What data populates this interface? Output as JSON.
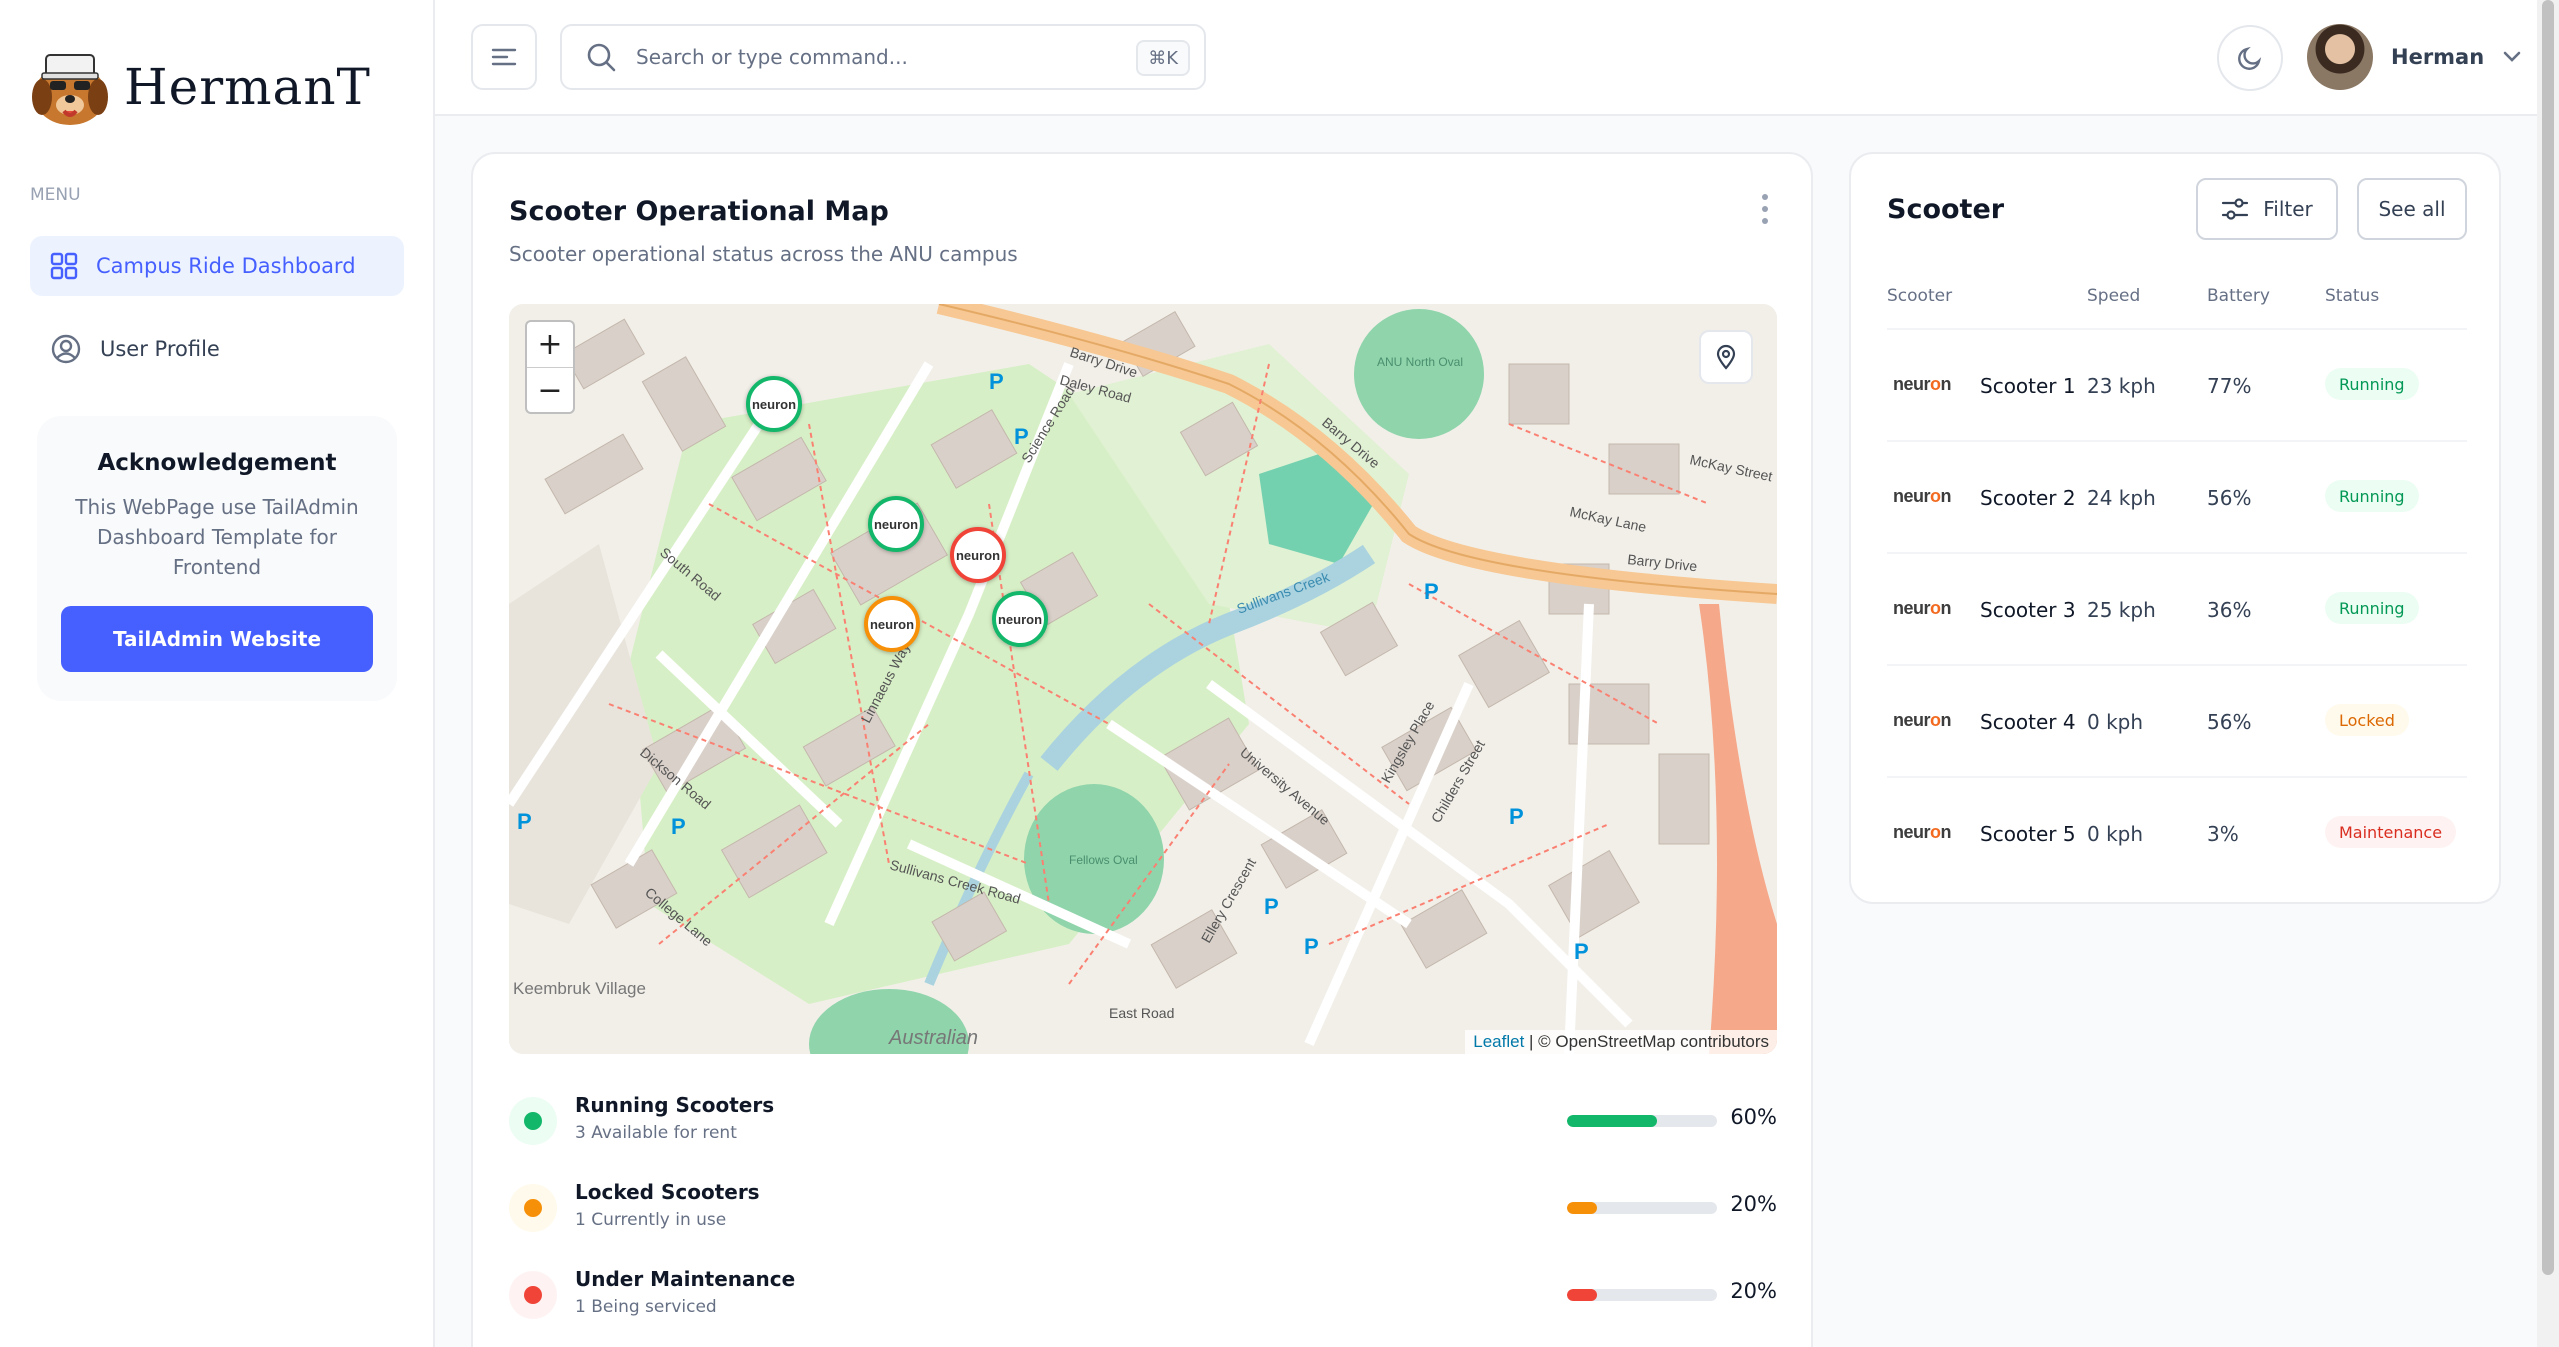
{
  "brand": {
    "name": "HermanT"
  },
  "sidebar": {
    "menu_label": "MENU",
    "items": [
      {
        "label": "Campus Ride Dashboard",
        "icon": "grid-icon",
        "active": true
      },
      {
        "label": "User Profile",
        "icon": "user-circle-icon",
        "active": false
      }
    ],
    "ack": {
      "title": "Acknowledgement",
      "text": "This WebPage use TailAdmin Dashboard Template for Frontend",
      "button": "TailAdmin Website"
    }
  },
  "header": {
    "search_placeholder": "Search or type command...",
    "shortcut": "⌘K",
    "user_name": "Herman"
  },
  "map_card": {
    "title": "Scooter Operational Map",
    "subtitle": "Scooter operational status across the ANU campus",
    "zoom_in": "+",
    "zoom_out": "−",
    "attribution_link": "Leaflet",
    "attribution_text": "| © OpenStreetMap contributors",
    "marker_label": "neuron",
    "map_labels": {
      "barry_drive_1": "Barry Drive",
      "barry_drive_2": "Barry Drive",
      "barry_drive_3": "Barry Drive",
      "daley_road": "Daley Road",
      "north_oval": "ANU North Oval",
      "fellows_oval": "Fellows Oval",
      "university_ave": "University Avenue",
      "sullivans_creek": "Sullivans Creek",
      "sullivans_creek_road": "Sullivans Creek Road",
      "college_lane": "College Lane",
      "keembruk": "Keembruk Village",
      "australian": "Australian",
      "east_road": "East Road",
      "mckay_lane": "McKay Lane",
      "mckay_street": "McKay Street",
      "kingsley_place": "Kingsley Place",
      "childers_street": "Childers Street",
      "linnaeus_way": "Linnaeus Way",
      "science_road": "Science Road",
      "dickson_road": "Dickson Road",
      "south_road": "South Road",
      "ellery_crescent": "Ellery Crescent"
    },
    "legend": [
      {
        "title": "Running Scooters",
        "sub": "3 Available for rent",
        "pct": "60%",
        "value": 60,
        "color": "#12b76a",
        "bg": "#ecfdf3"
      },
      {
        "title": "Locked Scooters",
        "sub": "1 Currently in use",
        "pct": "20%",
        "value": 20,
        "color": "#f79009",
        "bg": "#fffaeb"
      },
      {
        "title": "Under Maintenance",
        "sub": "1 Being serviced",
        "pct": "20%",
        "value": 20,
        "color": "#f04438",
        "bg": "#fef3f2"
      }
    ]
  },
  "scooter_table": {
    "title": "Scooter",
    "filter_label": "Filter",
    "see_all_label": "See all",
    "columns": [
      "Scooter",
      "Speed",
      "Battery",
      "Status"
    ],
    "rows": [
      {
        "brand": "neuron",
        "name": "Scooter 1",
        "speed": "23 kph",
        "battery": "77%",
        "status": "Running"
      },
      {
        "brand": "neuron",
        "name": "Scooter 2",
        "speed": "24 kph",
        "battery": "56%",
        "status": "Running"
      },
      {
        "brand": "neuron",
        "name": "Scooter 3",
        "speed": "25 kph",
        "battery": "36%",
        "status": "Running"
      },
      {
        "brand": "neuron",
        "name": "Scooter 4",
        "speed": "0 kph",
        "battery": "56%",
        "status": "Locked"
      },
      {
        "brand": "neuron",
        "name": "Scooter 5",
        "speed": "0 kph",
        "battery": "3%",
        "status": "Maintenance"
      }
    ],
    "status_colors": {
      "Running": {
        "fg": "#039855",
        "bg": "#ecfdf3"
      },
      "Locked": {
        "fg": "#dc6803",
        "bg": "#fffaeb"
      },
      "Maintenance": {
        "fg": "#d92d20",
        "bg": "#fef3f2"
      }
    }
  },
  "colors": {
    "accent": "#465fff",
    "running": "#12b76a",
    "locked": "#f79009",
    "maintenance": "#f04438"
  }
}
